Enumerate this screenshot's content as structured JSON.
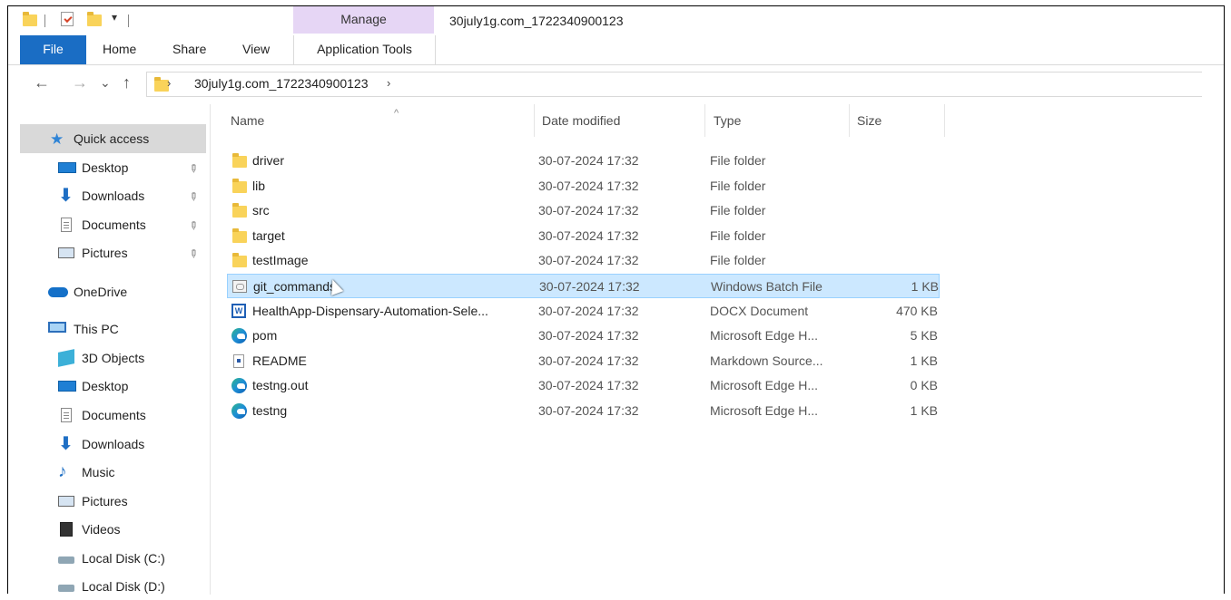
{
  "window": {
    "title": "30july1g.com_1722340900123",
    "qa_dropdown_glyph": "▾",
    "manage_label": "Manage"
  },
  "ribbon": {
    "tabs": [
      "File",
      "Home",
      "Share",
      "View",
      "Application Tools"
    ]
  },
  "address": {
    "back_glyph": "←",
    "forward_glyph": "→",
    "recent_glyph": "⌄",
    "up_glyph": "↑",
    "sep_glyph": "›",
    "path": "30july1g.com_1722340900123"
  },
  "sidebar": {
    "quick_access": "Quick access",
    "items": [
      {
        "label": "Desktop",
        "icon": "desktop-icon",
        "pinned": true
      },
      {
        "label": "Downloads",
        "icon": "download-icon",
        "pinned": true
      },
      {
        "label": "Documents",
        "icon": "documents-icon",
        "pinned": true
      },
      {
        "label": "Pictures",
        "icon": "pictures-icon",
        "pinned": true
      },
      {
        "label": "OneDrive",
        "icon": "onedrive-icon"
      },
      {
        "label": "This PC",
        "icon": "this-pc-icon"
      },
      {
        "label": "3D Objects",
        "icon": "3d-objects-icon"
      },
      {
        "label": "Desktop",
        "icon": "desktop-icon"
      },
      {
        "label": "Documents",
        "icon": "documents-icon"
      },
      {
        "label": "Downloads",
        "icon": "download-icon"
      },
      {
        "label": "Music",
        "icon": "music-icon"
      },
      {
        "label": "Pictures",
        "icon": "pictures-icon"
      },
      {
        "label": "Videos",
        "icon": "videos-icon"
      },
      {
        "label": "Local Disk (C:)",
        "icon": "local-disk-icon"
      },
      {
        "label": "Local Disk (D:)",
        "icon": "local-disk-icon"
      }
    ],
    "pin_glyph": "📌"
  },
  "columns": {
    "name": "Name",
    "date": "Date modified",
    "type": "Type",
    "size": "Size",
    "sort_glyph": "^"
  },
  "files": [
    {
      "name": "driver",
      "date": "30-07-2024 17:32",
      "type": "File folder",
      "size": "",
      "icon": "folder-icon"
    },
    {
      "name": "lib",
      "date": "30-07-2024 17:32",
      "type": "File folder",
      "size": "",
      "icon": "folder-icon"
    },
    {
      "name": "src",
      "date": "30-07-2024 17:32",
      "type": "File folder",
      "size": "",
      "icon": "folder-icon"
    },
    {
      "name": "target",
      "date": "30-07-2024 17:32",
      "type": "File folder",
      "size": "",
      "icon": "folder-icon"
    },
    {
      "name": "testImage",
      "date": "30-07-2024 17:32",
      "type": "File folder",
      "size": "",
      "icon": "folder-icon"
    },
    {
      "name": "git_commands",
      "date": "30-07-2024 17:32",
      "type": "Windows Batch File",
      "size": "1 KB",
      "icon": "batch-file-icon",
      "selected": true
    },
    {
      "name": "HealthApp-Dispensary-Automation-Sele...",
      "date": "30-07-2024 17:32",
      "type": "DOCX Document",
      "size": "470 KB",
      "icon": "word-document-icon"
    },
    {
      "name": "pom",
      "date": "30-07-2024 17:32",
      "type": "Microsoft Edge H...",
      "size": "5 KB",
      "icon": "edge-html-icon"
    },
    {
      "name": "README",
      "date": "30-07-2024 17:32",
      "type": "Markdown Source...",
      "size": "1 KB",
      "icon": "markdown-file-icon"
    },
    {
      "name": "testng.out",
      "date": "30-07-2024 17:32",
      "type": "Microsoft Edge H...",
      "size": "0 KB",
      "icon": "edge-html-icon"
    },
    {
      "name": "testng",
      "date": "30-07-2024 17:32",
      "type": "Microsoft Edge H...",
      "size": "1 KB",
      "icon": "edge-html-icon"
    }
  ]
}
